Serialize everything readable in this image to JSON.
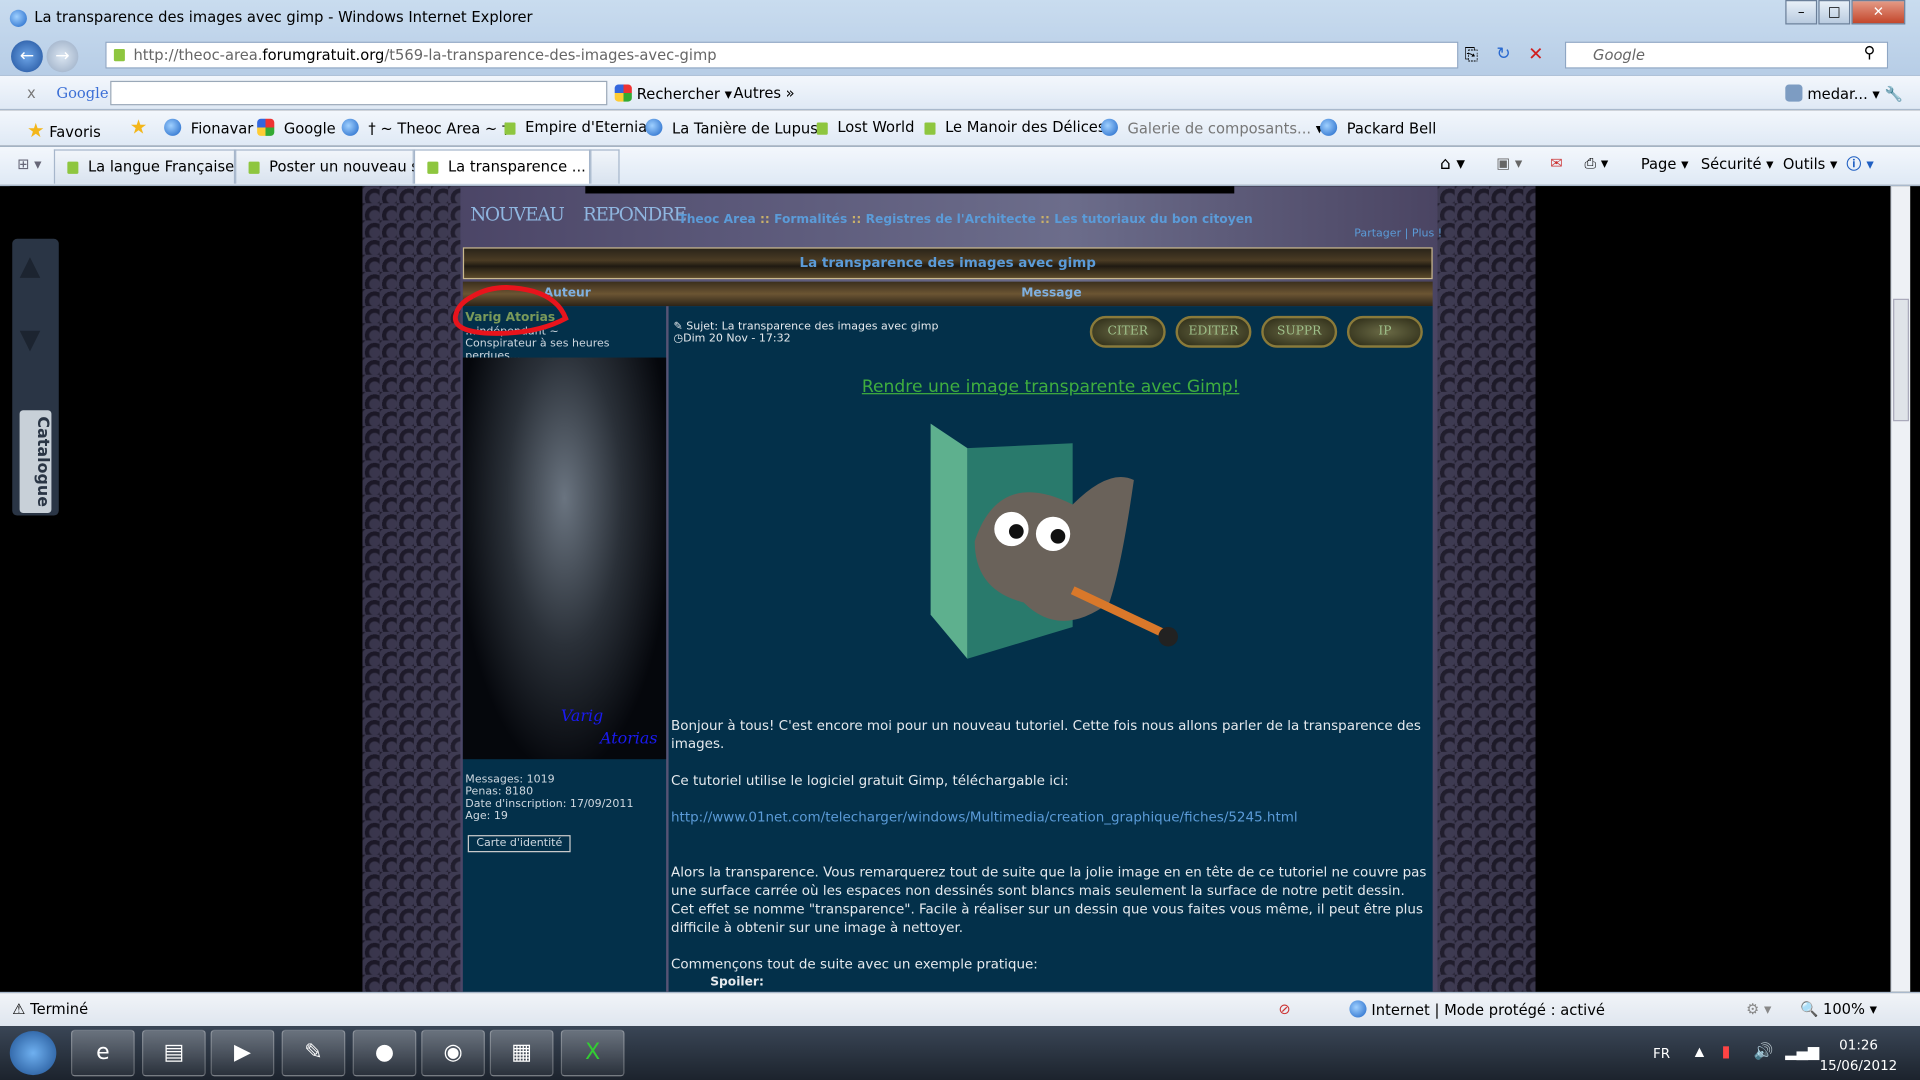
{
  "window": {
    "title": "La transparence des images avec gimp - Windows Internet Explorer",
    "url_prefix": "http://theoc-area.",
    "url_domain": "forumgratuit.org",
    "url_path": "/t569-la-transparence-des-images-avec-gimp",
    "search_placeholder": "Google"
  },
  "google_bar": {
    "close": "x",
    "logo": "Google",
    "search_button": "Rechercher",
    "more": "Autres",
    "user": "medar..."
  },
  "favorites": {
    "label": "Favoris",
    "items": [
      {
        "label": "Fionavar",
        "icon": "ie-icon"
      },
      {
        "label": "Google",
        "icon": "google-icon"
      },
      {
        "label": "† ~ Theoc Area ~ †",
        "icon": "ie-icon"
      },
      {
        "label": "Empire d'Eternia",
        "icon": "forum-icon"
      },
      {
        "label": "La Tanière de Lupus",
        "icon": "ie-icon"
      },
      {
        "label": "Lost World",
        "icon": "forum-icon"
      },
      {
        "label": "Le Manoir des Délices",
        "icon": "forum-icon"
      },
      {
        "label": "Galerie de composants...",
        "icon": "ie-icon"
      },
      {
        "label": "Packard Bell",
        "icon": "ie-icon"
      }
    ]
  },
  "tabs": [
    {
      "label": "La langue Française ..."
    },
    {
      "label": "Poster un nouveau s..."
    },
    {
      "label": "La transparence ...",
      "active": true
    }
  ],
  "command_bar": {
    "page": "Page",
    "security": "Sécurité",
    "tools": "Outils"
  },
  "forum": {
    "new_button": "NOUVEAU",
    "reply_button": "REPONDRE",
    "breadcrumb": [
      "Theoc Area",
      "Formalités",
      "Registres de l'Architecte",
      "Les tutoriaux du bon citoyen"
    ],
    "share": "Partager",
    "more": "Plus !",
    "topic_title": "La transparence des images avec gimp",
    "col_author": "Auteur",
    "col_message": "Message",
    "author": {
      "name": "Varig Atorias",
      "rank": "…indépendant ~",
      "rank2": "Conspirateur à ses heures perdues...",
      "avatar_sig1": "Varig",
      "avatar_sig2": "Atorias",
      "messages": "Messages: 1019",
      "penas": "Penas: 8180",
      "joined": "Date d'inscription: 17/09/2011",
      "age": "Age: 19",
      "id_card": "Carte d'identité"
    },
    "post": {
      "subject": "Sujet: La transparence des images avec gimp",
      "date": "Dim 20 Nov - 17:32",
      "buttons": [
        "CITER",
        "EDITER",
        "SUPPR",
        "IP"
      ],
      "heading": "Rendre une image transparente avec Gimp!",
      "p1": "Bonjour à tous! C'est encore moi pour un nouveau tutoriel. Cette fois nous allons parler de la transparence des images.",
      "p2": "Ce tutoriel utilise le logiciel gratuit Gimp, téléchargable ici:",
      "link": "http://www.01net.com/telecharger/windows/Multimedia/creation_graphique/fiches/5245.html",
      "p3": "Alors la transparence. Vous remarquerez tout de suite que la jolie image en en tête de ce tutoriel ne couvre pas une surface carrée où les espaces non dessinés sont blancs mais seulement la surface de notre petit dessin. Cet effet se nomme \"transparence\". Facile à réaliser sur un dessin que vous faites vous même, il peut être plus difficile à obtenir sur une image à nettoyer.",
      "p4": "Commençons tout de suite avec un exemple pratique:",
      "spoiler": "Spoiler:"
    }
  },
  "side_panel": {
    "label": "Catalogue"
  },
  "statusbar": {
    "text": "Terminé",
    "zone": "Internet | Mode protégé : activé",
    "zoom": "100%"
  },
  "tray": {
    "lang": "FR",
    "time": "01:26",
    "date": "15/06/2012"
  },
  "colors": {
    "link": "#5b9bd8",
    "post_bg": "#03304a",
    "heading": "#3fae3f",
    "annotation": "#e8141c"
  }
}
